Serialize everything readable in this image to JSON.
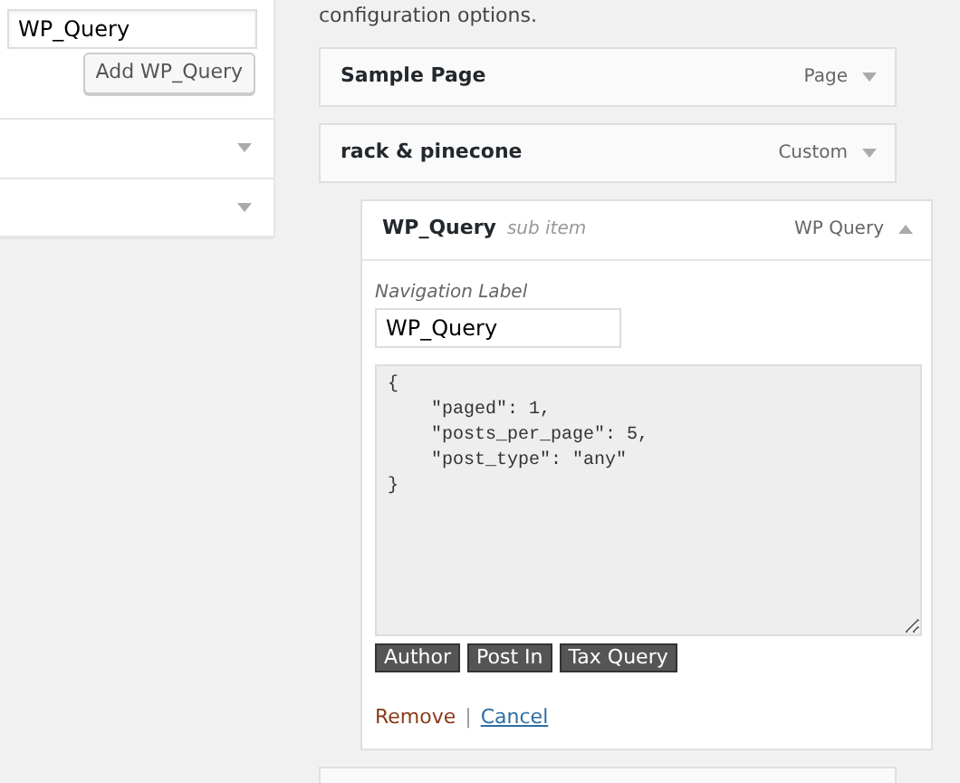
{
  "left_panel": {
    "search": {
      "value": "WP_Query"
    },
    "add_button": "Add WP_Query",
    "sections": [
      {
        "expanded": false
      },
      {
        "expanded": false
      }
    ]
  },
  "menu": {
    "intro": "configuration options.",
    "items": [
      {
        "title": "Sample Page",
        "type": "Page",
        "expanded": false
      },
      {
        "title": "rack & pinecone",
        "type": "Custom",
        "expanded": false,
        "children": [
          {
            "title": "WP_Query",
            "note": "sub item",
            "type": "WP Query",
            "expanded": true,
            "settings": {
              "label": "Navigation Label",
              "value": "WP_Query",
              "query": "{\n    \"paged\": 1,\n    \"posts_per_page\": 5,\n    \"post_type\": \"any\"\n}",
              "tag_buttons": [
                "Author",
                "Post In",
                "Tax Query"
              ],
              "remove": "Remove",
              "separator": "|",
              "cancel": "Cancel"
            }
          }
        ]
      }
    ]
  }
}
